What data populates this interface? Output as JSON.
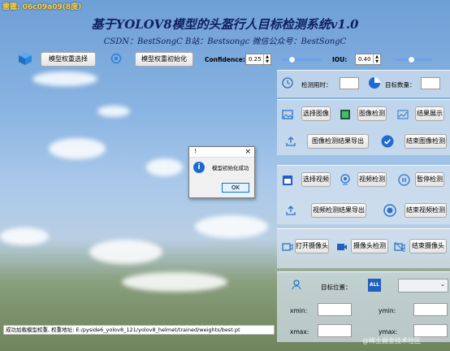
{
  "window": {
    "app_name": "雷霆: 06c09a09(8度)"
  },
  "header": {
    "title": "基于YOLOV8模型的头盔行人目标检测系统v1.0",
    "subtitle": "CSDN：BestSongC   B站：Bestsongc   微信公众号：BestSongC"
  },
  "toolbar": {
    "select_weights": "模型权重选择",
    "init_weights": "模型权重初始化",
    "confidence_label": "Confidence:",
    "confidence_value": "0.25",
    "iou_label": "IOU:",
    "iou_value": "0.40",
    "confidence_level": 0.25,
    "iou_level": 0.4
  },
  "stats": {
    "time_label": "检测用时：",
    "count_label": "目标数量："
  },
  "image_section": {
    "select": "选择图像",
    "detect": "图像检测",
    "show": "结果展示",
    "export": "图像检测结果导出",
    "stop": "结束图像检测"
  },
  "video_section": {
    "select": "选择视频",
    "detect": "视频检测",
    "pause": "暂停检测",
    "export": "视频检测结果导出",
    "stop": "结束视频检测"
  },
  "camera_section": {
    "open": "打开摄像头",
    "detect": "摄像头检测",
    "close": "结束摄像头"
  },
  "position": {
    "label": "目标位置：",
    "all": "ALL",
    "xmin": "xmin:",
    "ymin": "ymin:",
    "xmax": "xmax:",
    "ymax": "ymax:"
  },
  "status": {
    "text": "成功加载模型权重, 权重地址: E:/pyside6_yolov8_121/yolov8_helmet/trained/weights/best.pt"
  },
  "dialog": {
    "title": "!",
    "message": "模型初始化成功",
    "ok": "OK",
    "close": "×"
  },
  "watermark": "@稀土掘金技术社区"
}
